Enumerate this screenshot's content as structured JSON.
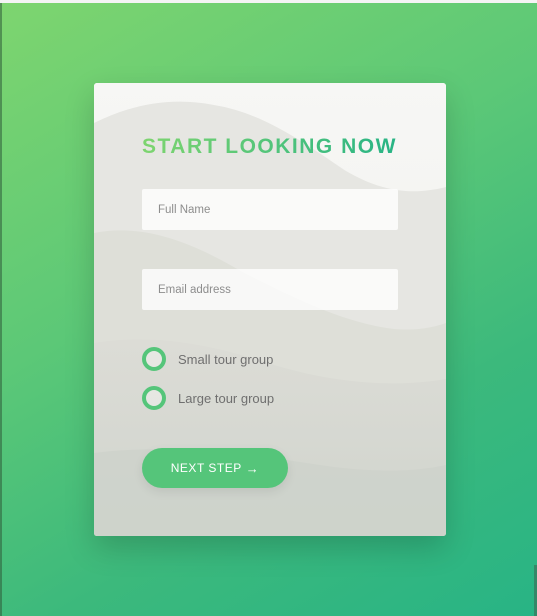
{
  "form": {
    "title": "START LOOKING NOW",
    "fields": {
      "full_name": {
        "placeholder": "Full Name",
        "value": ""
      },
      "email": {
        "placeholder": "Email address",
        "value": ""
      }
    },
    "options": [
      {
        "label": "Small tour group"
      },
      {
        "label": "Large tour group"
      }
    ],
    "next_button": {
      "label": "NEXT STEP",
      "icon": "arrow-right-icon",
      "glyph": "→"
    }
  },
  "colors": {
    "gradient_start": "#7ed56f",
    "gradient_end": "#28b485",
    "accent": "#55c57a",
    "label_text": "#6f6f6f"
  }
}
